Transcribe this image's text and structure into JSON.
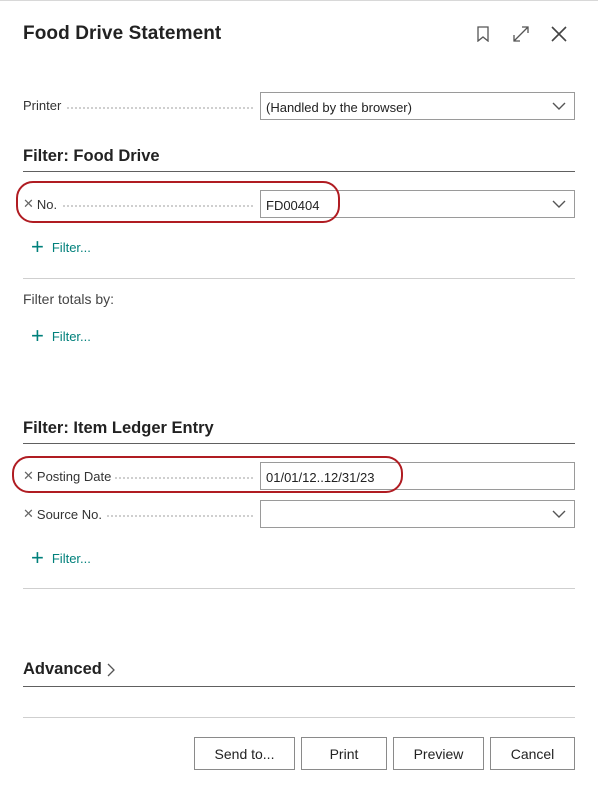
{
  "dialog": {
    "title": "Food Drive Statement",
    "icons": [
      "bookmark-icon",
      "expand-icon",
      "close-icon"
    ]
  },
  "printer": {
    "label": "Printer",
    "value": "(Handled by the browser)"
  },
  "filter_food_drive": {
    "title": "Filter: Food Drive",
    "no_label": "No.",
    "no_value": "FD00404",
    "add_filter": "Filter..."
  },
  "filter_totals": {
    "label": "Filter totals by:",
    "add_filter": "Filter..."
  },
  "filter_item_ledger": {
    "title": "Filter: Item Ledger Entry",
    "posting_date_label": "Posting Date",
    "posting_date_value": "01/01/12..12/31/23",
    "source_no_label": "Source No.",
    "source_no_value": "",
    "add_filter": "Filter..."
  },
  "advanced": {
    "label": "Advanced"
  },
  "buttons": {
    "send_to": "Send to...",
    "print": "Print",
    "preview": "Preview",
    "cancel": "Cancel"
  },
  "colors": {
    "accent": "#00807b",
    "highlight": "#b01c22"
  }
}
